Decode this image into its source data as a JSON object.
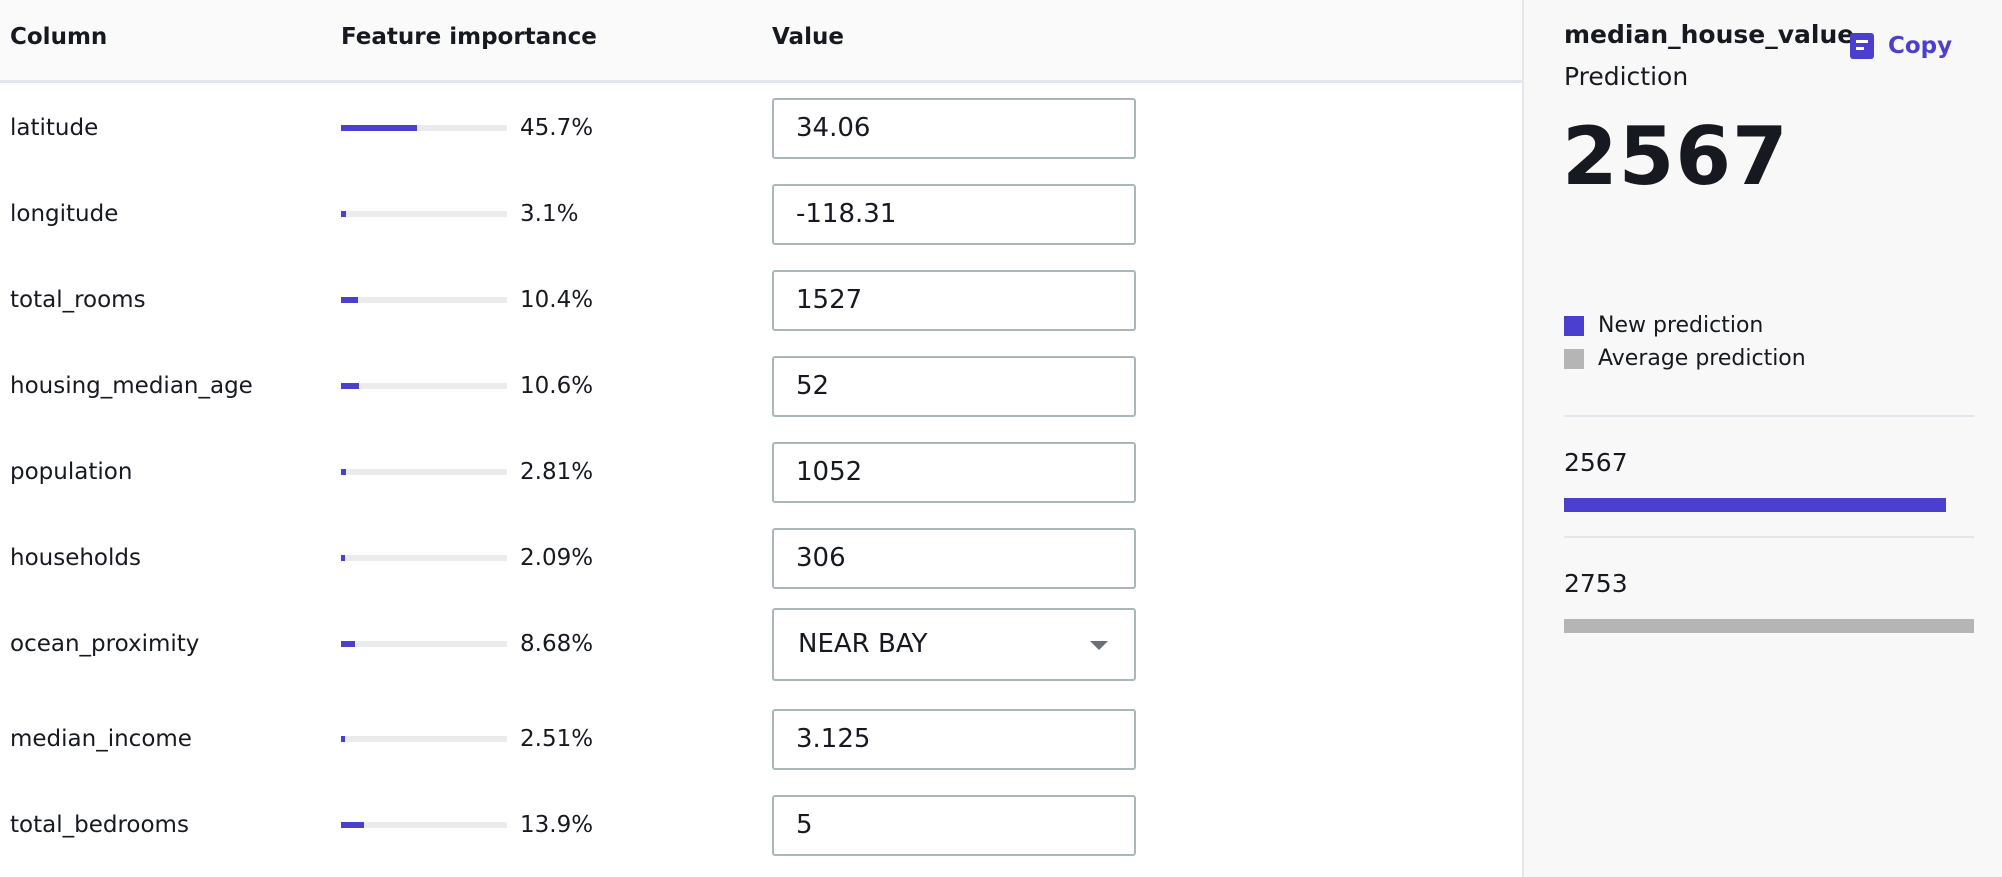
{
  "colors": {
    "accent": "#4a3fcf",
    "average": "#b5b5b5",
    "track": "#e9ebed"
  },
  "table": {
    "headers": {
      "column": "Column",
      "importance": "Feature importance",
      "value": "Value"
    },
    "rows": [
      {
        "name": "latitude",
        "importance_pct": "45.7%",
        "importance": 0.457,
        "value": "34.06",
        "kind": "input"
      },
      {
        "name": "longitude",
        "importance_pct": "3.1%",
        "importance": 0.031,
        "value": "-118.31",
        "kind": "input"
      },
      {
        "name": "total_rooms",
        "importance_pct": "10.4%",
        "importance": 0.104,
        "value": "1527",
        "kind": "input"
      },
      {
        "name": "housing_median_age",
        "importance_pct": "10.6%",
        "importance": 0.106,
        "value": "52",
        "kind": "input"
      },
      {
        "name": "population",
        "importance_pct": "2.81%",
        "importance": 0.0281,
        "value": "1052",
        "kind": "input"
      },
      {
        "name": "households",
        "importance_pct": "2.09%",
        "importance": 0.0209,
        "value": "306",
        "kind": "input"
      },
      {
        "name": "ocean_proximity",
        "importance_pct": "8.68%",
        "importance": 0.0868,
        "value": "NEAR BAY",
        "kind": "select"
      },
      {
        "name": "median_income",
        "importance_pct": "2.51%",
        "importance": 0.0251,
        "value": "3.125",
        "kind": "input"
      },
      {
        "name": "total_bedrooms",
        "importance_pct": "13.9%",
        "importance": 0.139,
        "value": "5",
        "kind": "input"
      }
    ]
  },
  "prediction": {
    "target": "median_house_value",
    "copy_label": "Copy",
    "copy_icon": "document-icon",
    "label": "Prediction",
    "value": "2567",
    "legend": [
      {
        "label": "New prediction",
        "color": "#4a3fcf"
      },
      {
        "label": "Average prediction",
        "color": "#b5b5b5"
      }
    ],
    "bars": [
      {
        "value": "2567",
        "num": 2567,
        "color": "#4a3fcf"
      },
      {
        "value": "2753",
        "num": 2753,
        "color": "#b5b5b5"
      }
    ]
  }
}
